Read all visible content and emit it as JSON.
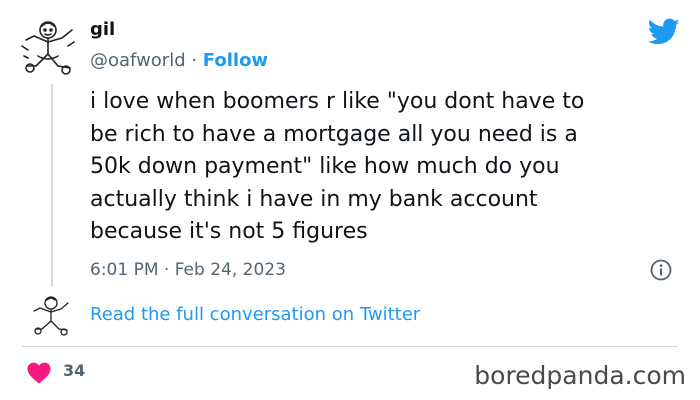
{
  "author": {
    "display_name": "gil",
    "handle": "@oafworld",
    "separator": " · ",
    "follow_label": "Follow",
    "avatar_icon": "cartoon-avatar-icon"
  },
  "tweet": {
    "text": "i love when boomers r like \"you dont have to\nbe rich to have a mortgage all you need is a\n50k down payment\" like how much do you\nactually think i have in my bank account\nbecause it's not 5 figures",
    "timestamp": "6:01 PM · Feb 24, 2023"
  },
  "conversation": {
    "link_label": "Read the full conversation on Twitter"
  },
  "engagement": {
    "like_count": "34",
    "like_icon": "heart-icon"
  },
  "watermark": {
    "text": "boredpanda.com"
  },
  "colors": {
    "accent": "#1d9bf0",
    "heart": "#f91880",
    "muted_text": "#536471",
    "divider": "#cfd9de"
  }
}
